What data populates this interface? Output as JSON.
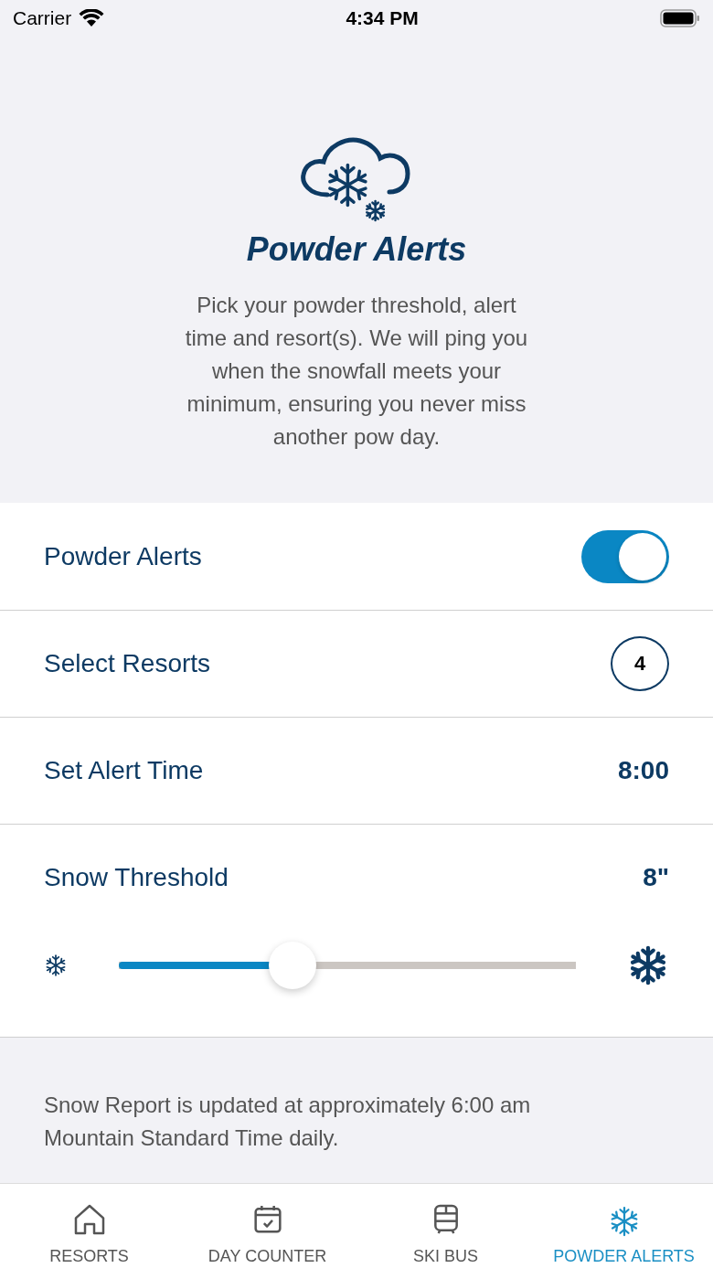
{
  "status_bar": {
    "carrier": "Carrier",
    "time": "4:34 PM"
  },
  "header": {
    "title": "Powder Alerts",
    "description": "Pick your powder threshold, alert time and resort(s). We will ping you when the snowfall meets your minimum, ensuring you never miss another pow day."
  },
  "settings": [
    {
      "kind": "toggle",
      "label": "Powder Alerts",
      "on": true
    },
    {
      "kind": "count",
      "label": "Select Resorts",
      "value": "4"
    },
    {
      "kind": "value",
      "label": "Set Alert Time",
      "value": "8:00"
    },
    {
      "kind": "slider",
      "label": "Snow Threshold",
      "value": "8\"",
      "level": 0.38
    }
  ],
  "note": "Snow Report is updated at approximately 6:00 am Mountain Standard Time daily.",
  "tabs": [
    {
      "label": "RESORTS",
      "selected": false
    },
    {
      "label": "DAY COUNTER",
      "selected": false
    },
    {
      "label": "SKI BUS",
      "selected": false
    },
    {
      "label": "POWDER ALERTS",
      "selected": true
    }
  ]
}
